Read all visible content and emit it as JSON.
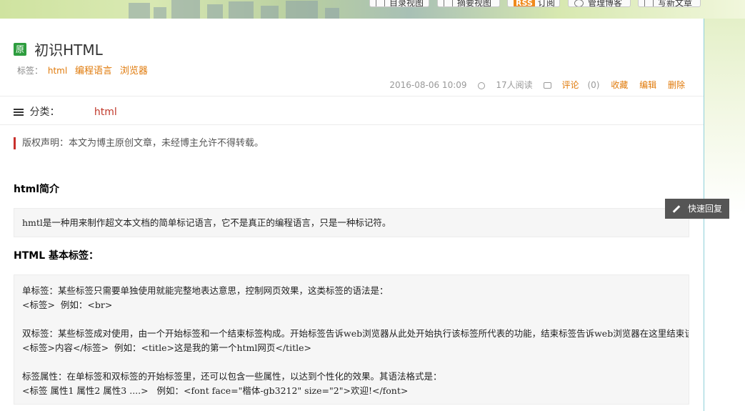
{
  "top_buttons": [
    {
      "label": "目录视图",
      "icon": "list-icon"
    },
    {
      "label": "摘要视图",
      "icon": "summary-icon"
    },
    {
      "label": "订阅",
      "icon": "rss-icon",
      "badge": "RSS"
    },
    {
      "label": "管理博客",
      "icon": "gear-icon"
    },
    {
      "label": "写新文章",
      "icon": "edit-icon"
    }
  ],
  "article": {
    "badge": "原",
    "title": "初识HTML",
    "tags_label": "标签：",
    "tags": [
      "html",
      "编程语言",
      "浏览器"
    ],
    "date": "2016-08-06 10:09",
    "reads": "17人阅读",
    "comment_label": "评论",
    "comment_count": "(0)",
    "favorite": "收藏",
    "edit": "编辑",
    "delete": "删除"
  },
  "category": {
    "label": "分类：",
    "value": "html"
  },
  "copyright": "版权声明：本文为博主原创文章，未经博主允许不得转载。",
  "sections": [
    {
      "heading": "html简介",
      "code": "hmtl是一种用来制作超文本文档的简单标记语言，它不是真正的编程语言，只是一种标记符。"
    },
    {
      "heading": "HTML 基本标签：",
      "code": "单标签：某些标签只需要单独使用就能完整地表达意思，控制网页效果，这类标签的语法是：\n<标签>  例如：<br>\n\n双标签：某些标签成对使用，由一个开始标签和一个结束标签构成。开始标签告诉web浏览器从此处开始执行该标签所代表的功能，结束标签告诉web浏览器在这里结束该功能。\n<标签>内容</标签>  例如：<title>这是我的第一个html网页</title>\n\n标签属性：在单标签和双标签的开始标签里，还可以包含一些属性，以达到个性化的效果。其语法格式是：\n<标签 属性1 属性2 属性3 ....>   例如：<font face=\"楷体-gb3212\" size=\"2\">欢迎!</font>"
    }
  ],
  "quick_reply": "快速回复",
  "colors": {
    "accent_orange": "#e07a0a",
    "category_red": "#c0392b",
    "original_green": "#2e9d3f"
  }
}
